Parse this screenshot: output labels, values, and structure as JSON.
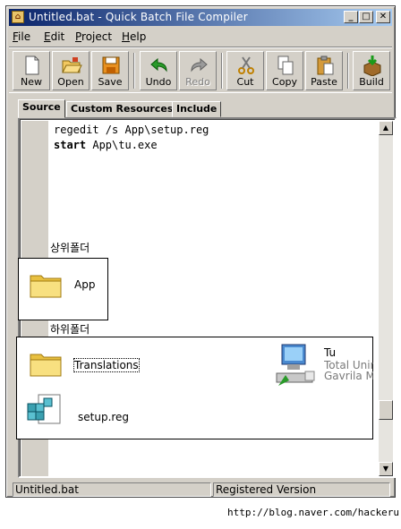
{
  "window": {
    "title": "Untitled.bat - Quick Batch File Compiler",
    "caption_buttons": {
      "minimize": "_",
      "maximize": "□",
      "close": "✕"
    }
  },
  "menu": [
    {
      "key": "F",
      "rest": "ile"
    },
    {
      "key": "E",
      "rest": "dit"
    },
    {
      "key": "P",
      "rest": "roject"
    },
    {
      "key": "H",
      "rest": "elp"
    }
  ],
  "toolbar": {
    "new": "New",
    "open": "Open",
    "save": "Save",
    "undo": "Undo",
    "redo": "Redo",
    "cut": "Cut",
    "copy": "Copy",
    "paste": "Paste",
    "build": "Build"
  },
  "tabs": [
    "Source",
    "Custom Resources",
    "Include"
  ],
  "editor": {
    "line1": "regedit /s App\\setup.reg",
    "line2_keyword": "start",
    "line2_rest": " App\\tu.exe"
  },
  "overlay": {
    "parent_folder_label": "상위폴더",
    "sub_folder_label": "하위폴더",
    "parent_folder_item": "App",
    "sub_items": {
      "folder": "Translations",
      "reg_file": "setup.reg",
      "exe_title": "Tu",
      "exe_line2": "Total Unins",
      "exe_line3": "Gavrila Ma"
    }
  },
  "status": {
    "file": "Untitled.bat",
    "license": "Registered Version"
  },
  "watermark": "http://blog.naver.com/hackeru",
  "colors": {
    "titlebar_start": "#0a246a",
    "titlebar_end": "#a6caf0",
    "face": "#d4d0c8"
  }
}
